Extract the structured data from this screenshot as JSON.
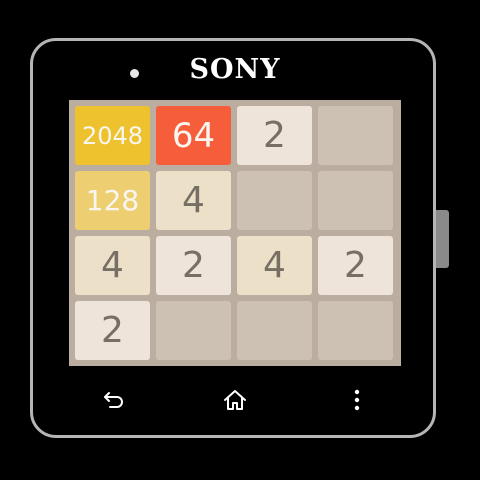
{
  "device": {
    "brand": "SONY"
  },
  "game": {
    "board": [
      [
        2048,
        64,
        2,
        0
      ],
      [
        128,
        4,
        0,
        0
      ],
      [
        4,
        2,
        4,
        2
      ],
      [
        2,
        0,
        0,
        0
      ]
    ]
  },
  "nav": {
    "back_icon": "back-arrow-icon",
    "home_icon": "home-icon",
    "menu_icon": "overflow-menu-icon"
  },
  "colors": {
    "board_background": "#bbada0",
    "empty_cell": "#cdc1b4",
    "tile_2": "#eee4da",
    "tile_4": "#ede0c8",
    "tile_64": "#f65e3b",
    "tile_128": "#edcf72",
    "tile_2048": "#edc22e",
    "dark_text": "#776e65",
    "light_text": "#f9f6f2"
  }
}
